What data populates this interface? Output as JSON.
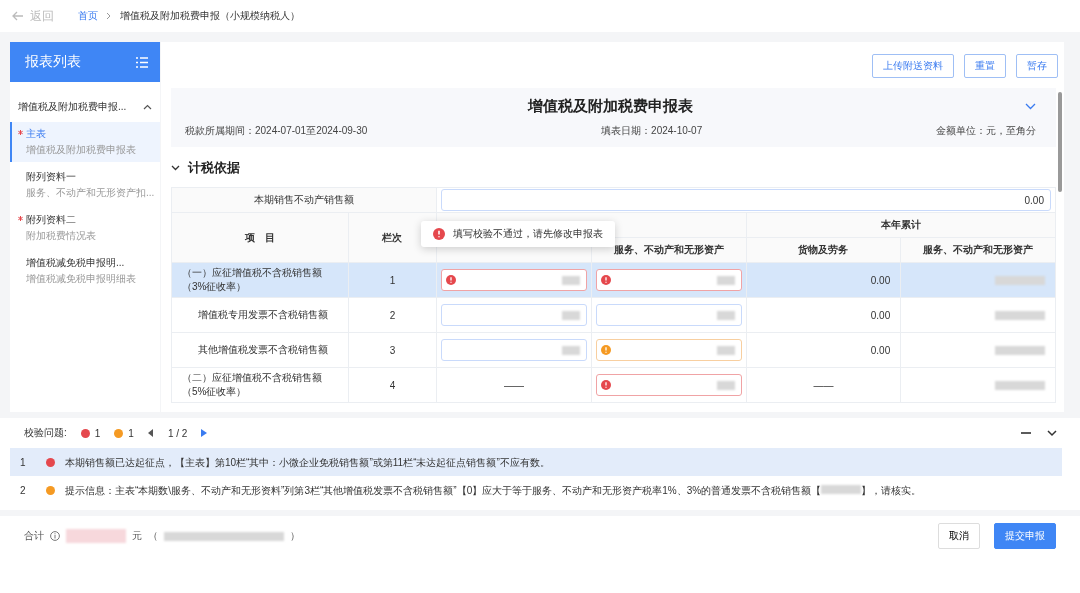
{
  "topbar": {
    "back": "返回",
    "breadcrumb": [
      {
        "label": "首页",
        "link": true
      },
      {
        "label": "增值税及附加税费申报（小规模纳税人）",
        "link": false
      }
    ]
  },
  "sidebar": {
    "title": "报表列表",
    "group": {
      "label": "增值税及附加税费申报...",
      "expanded": true
    },
    "items": [
      {
        "title": "主表",
        "subtitle": "增值税及附加税费申报表",
        "required": true,
        "selected": true
      },
      {
        "title": "附列资料一",
        "subtitle": "服务、不动产和无形资产扣...",
        "required": false,
        "selected": false
      },
      {
        "title": "附列资料二",
        "subtitle": "附加税费情况表",
        "required": true,
        "selected": false
      },
      {
        "title": "增值税减免税申报明...",
        "subtitle": "增值税减免税申报明细表",
        "required": false,
        "selected": false
      }
    ]
  },
  "actions": [
    "上传附送资料",
    "重置",
    "暂存"
  ],
  "form": {
    "title": "增值税及附加税费申报表",
    "expanded": true,
    "period_label": "税款所属期间：",
    "period": "2024-07-01至2024-09-30",
    "date_label": "填表日期：",
    "date": "2024-10-07",
    "unit": "金额单位：元，至角分",
    "section": {
      "title": "计税依据",
      "expanded": true
    },
    "property_sales": {
      "label": "本期销售不动产销售额",
      "value": "0.00"
    },
    "columns": {
      "item": "项　目",
      "line": "栏次",
      "year": "本年累计",
      "current_services": "服务、不动产和无形资产",
      "year_goods": "货物及劳务",
      "year_services": "服务、不动产和无形资产"
    },
    "rows": [
      {
        "item": "（一）应征增值税不含税销售额（3%征收率）",
        "line": "1",
        "indent": false,
        "selected": true,
        "cells": [
          {
            "kind": "input",
            "error": true,
            "warning": false
          },
          {
            "kind": "input",
            "error": true,
            "warning": false
          },
          {
            "kind": "text",
            "value": "0.00"
          },
          {
            "kind": "redacted"
          }
        ]
      },
      {
        "item": "增值税专用发票不含税销售额",
        "line": "2",
        "indent": true,
        "selected": false,
        "cells": [
          {
            "kind": "input",
            "error": false,
            "warning": false
          },
          {
            "kind": "input",
            "error": false,
            "warning": false
          },
          {
            "kind": "text",
            "value": "0.00"
          },
          {
            "kind": "redacted"
          }
        ]
      },
      {
        "item": "其他增值税发票不含税销售额",
        "line": "3",
        "indent": true,
        "selected": false,
        "cells": [
          {
            "kind": "input",
            "error": false,
            "warning": false
          },
          {
            "kind": "input",
            "error": false,
            "warning": true
          },
          {
            "kind": "text",
            "value": "0.00"
          },
          {
            "kind": "redacted"
          }
        ]
      },
      {
        "item": "（二）应征增值税不含税销售额（5%征收率）",
        "line": "4",
        "indent": false,
        "selected": false,
        "cells": [
          {
            "kind": "text",
            "value": "——"
          },
          {
            "kind": "input",
            "error": true,
            "warning": false
          },
          {
            "kind": "text",
            "value": "——"
          },
          {
            "kind": "redacted"
          }
        ]
      }
    ]
  },
  "toast": {
    "text": "填写校验不通过，请先修改申报表"
  },
  "validation": {
    "label": "校验问题:",
    "errors": "1",
    "warnings": "1",
    "page": "1 / 2",
    "issues": [
      {
        "index": "1",
        "error": true,
        "selected": true,
        "text": "本期销售额已达起征点，【主表】第10栏“其中：小微企业免税销售额”或第11栏“未达起征点销售额”不应有数。"
      },
      {
        "index": "2",
        "error": false,
        "selected": false,
        "text": "提示信息：主表“本期数\\服务、不动产和无形资料”列第3栏“其他增值税发票不含税销售额”【0】应大于等于服务、不动产和无形资产税率1%、3%的普通发票不含税销售额【",
        "text_after": "】，请核实。"
      }
    ]
  },
  "footer": {
    "total_label": "合计",
    "unit": "元",
    "open_paren": "（",
    "close_paren": "）",
    "buttons": [
      {
        "label": "取消",
        "primary": false
      },
      {
        "label": "提交申报",
        "primary": true
      }
    ]
  }
}
